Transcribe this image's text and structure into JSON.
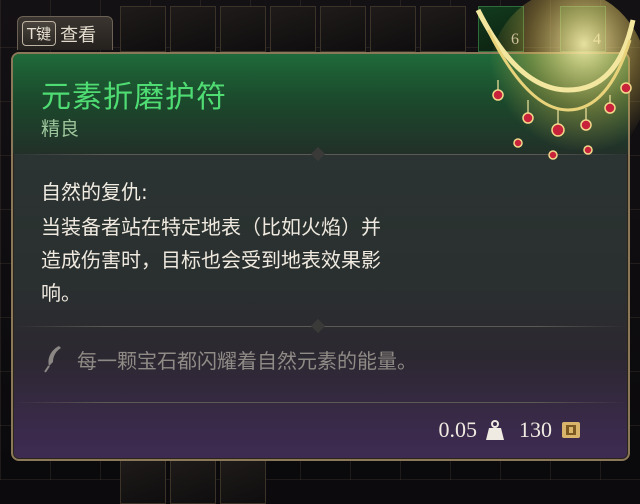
{
  "key_hint": {
    "key": "T键",
    "action": "查看"
  },
  "inventory": {
    "slot_counts": [
      "6",
      "4"
    ]
  },
  "item": {
    "name": "元素折磨护符",
    "rarity": "精良",
    "effect_title": "自然的复仇:",
    "effect_lines": [
      "当装备者站在特定地表（比如火焰）并",
      "造成伤害时，目标也会受到地表效果影",
      "响。"
    ],
    "flavor": "每一颗宝石都闪耀着自然元素的能量。",
    "weight": "0.05",
    "value": "130"
  },
  "colors": {
    "name": "#4fdc73",
    "rarity": "#9cc49a",
    "header_bg": "#1f6a3a",
    "frame": "#8a7858"
  },
  "icons": {
    "weight": "weight-icon",
    "value": "gold-coin-icon",
    "flavor": "quill-icon",
    "item": "amulet-icon"
  }
}
